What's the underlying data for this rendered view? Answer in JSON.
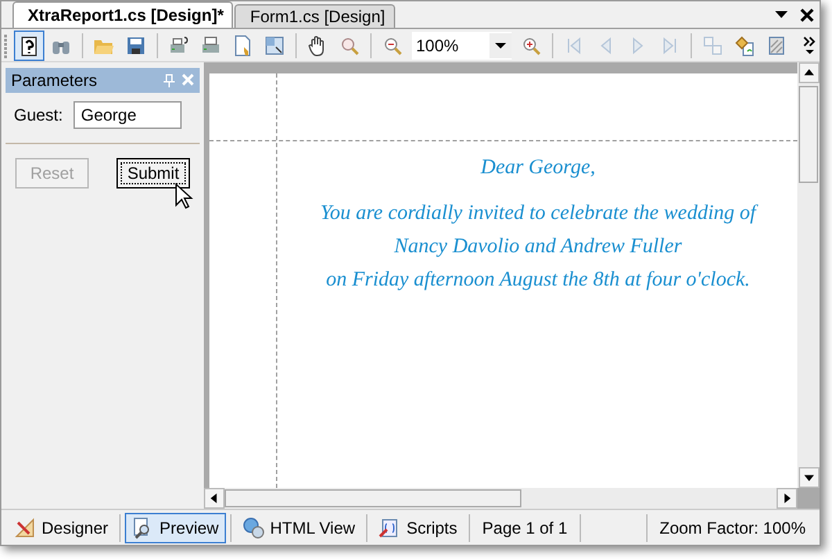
{
  "document_tabs": [
    {
      "label": "XtraReport1.cs [Design]*",
      "selected": true
    },
    {
      "label": "Form1.cs [Design]",
      "selected": false
    }
  ],
  "toolbar": [
    {
      "kind": "button",
      "selected": true,
      "disabled": false
    },
    {
      "kind": "button",
      "selected": false,
      "disabled": false
    },
    {
      "kind": "separator"
    },
    {
      "kind": "button",
      "selected": false,
      "disabled": false
    },
    {
      "kind": "button",
      "selected": false,
      "disabled": false
    },
    {
      "kind": "separator"
    },
    {
      "kind": "button",
      "selected": false,
      "disabled": false
    },
    {
      "kind": "button",
      "selected": false,
      "disabled": false
    },
    {
      "kind": "button",
      "selected": false,
      "disabled": false
    },
    {
      "kind": "button",
      "selected": false,
      "disabled": false
    },
    {
      "kind": "separator"
    },
    {
      "kind": "button",
      "selected": false,
      "disabled": false
    },
    {
      "kind": "button",
      "selected": false,
      "disabled": false
    },
    {
      "kind": "separator"
    },
    {
      "kind": "button",
      "selected": false,
      "disabled": false
    },
    {
      "kind": "combo",
      "value": "100%"
    },
    {
      "kind": "button",
      "selected": false,
      "disabled": false
    },
    {
      "kind": "separator"
    },
    {
      "kind": "button",
      "selected": false,
      "disabled": true
    },
    {
      "kind": "button",
      "selected": false,
      "disabled": true
    },
    {
      "kind": "button",
      "selected": false,
      "disabled": true
    },
    {
      "kind": "button",
      "selected": false,
      "disabled": true
    },
    {
      "kind": "separator"
    },
    {
      "kind": "button",
      "selected": false,
      "disabled": true
    },
    {
      "kind": "button",
      "selected": false,
      "disabled": false
    },
    {
      "kind": "button",
      "selected": false,
      "disabled": false
    }
  ],
  "parameters_panel": {
    "title": "Parameters",
    "fields": [
      {
        "label": "Guest:",
        "value": "George"
      }
    ],
    "buttons": [
      {
        "label": "Reset",
        "disabled": true,
        "focused": false
      },
      {
        "label": "Submit",
        "disabled": false,
        "focused": true
      }
    ]
  },
  "report": {
    "lines": [
      "Dear George,",
      "You are cordially invited to celebrate the wedding of",
      "Nancy Davolio and Andrew Fuller",
      "on Friday afternoon August the 8th at four o'clock."
    ]
  },
  "view_tabs": [
    {
      "label": "Designer",
      "selected": false
    },
    {
      "label": "Preview",
      "selected": true
    },
    {
      "label": "HTML View",
      "selected": false
    },
    {
      "label": "Scripts",
      "selected": false
    }
  ],
  "status_bar": {
    "page": "Page 1 of 1",
    "zoom": "Zoom Factor: 100%"
  }
}
